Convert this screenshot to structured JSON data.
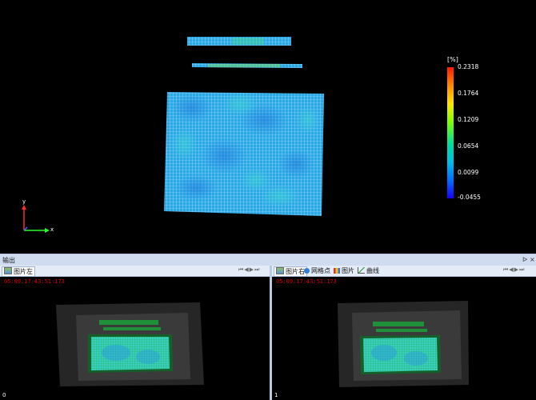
{
  "viewport": {
    "colorbar": {
      "unit": "[%]",
      "ticks": [
        "0.2318",
        "0.1764",
        "0.1209",
        "0.0654",
        "0.0099",
        "-0.0455"
      ],
      "colors": [
        "#ff1a00",
        "#ff8c00",
        "#ffe600",
        "#7fff00",
        "#00e09a",
        "#00bfe6",
        "#0070ff",
        "#1a00ff"
      ]
    },
    "axes": {
      "y_label": "y",
      "x_label": "x"
    },
    "mesh_color": "#1fa3e0"
  },
  "output_panel": {
    "title": "输出",
    "pin_icon": "pin-icon",
    "close_icon": "close-icon",
    "left_pane": {
      "tab_label": "图片左",
      "timestamp": "05:09:17:43:51:173",
      "index": "0"
    },
    "right_pane": {
      "tabs": [
        {
          "label": "图片右",
          "icon": "image-icon"
        },
        {
          "label": "网格点",
          "icon": "grid-points-icon"
        },
        {
          "label": "图片",
          "icon": "picture-icon"
        },
        {
          "label": "曲线",
          "icon": "curve-icon"
        }
      ],
      "timestamp": "05:09:17:43:51:173",
      "index": "1"
    }
  }
}
